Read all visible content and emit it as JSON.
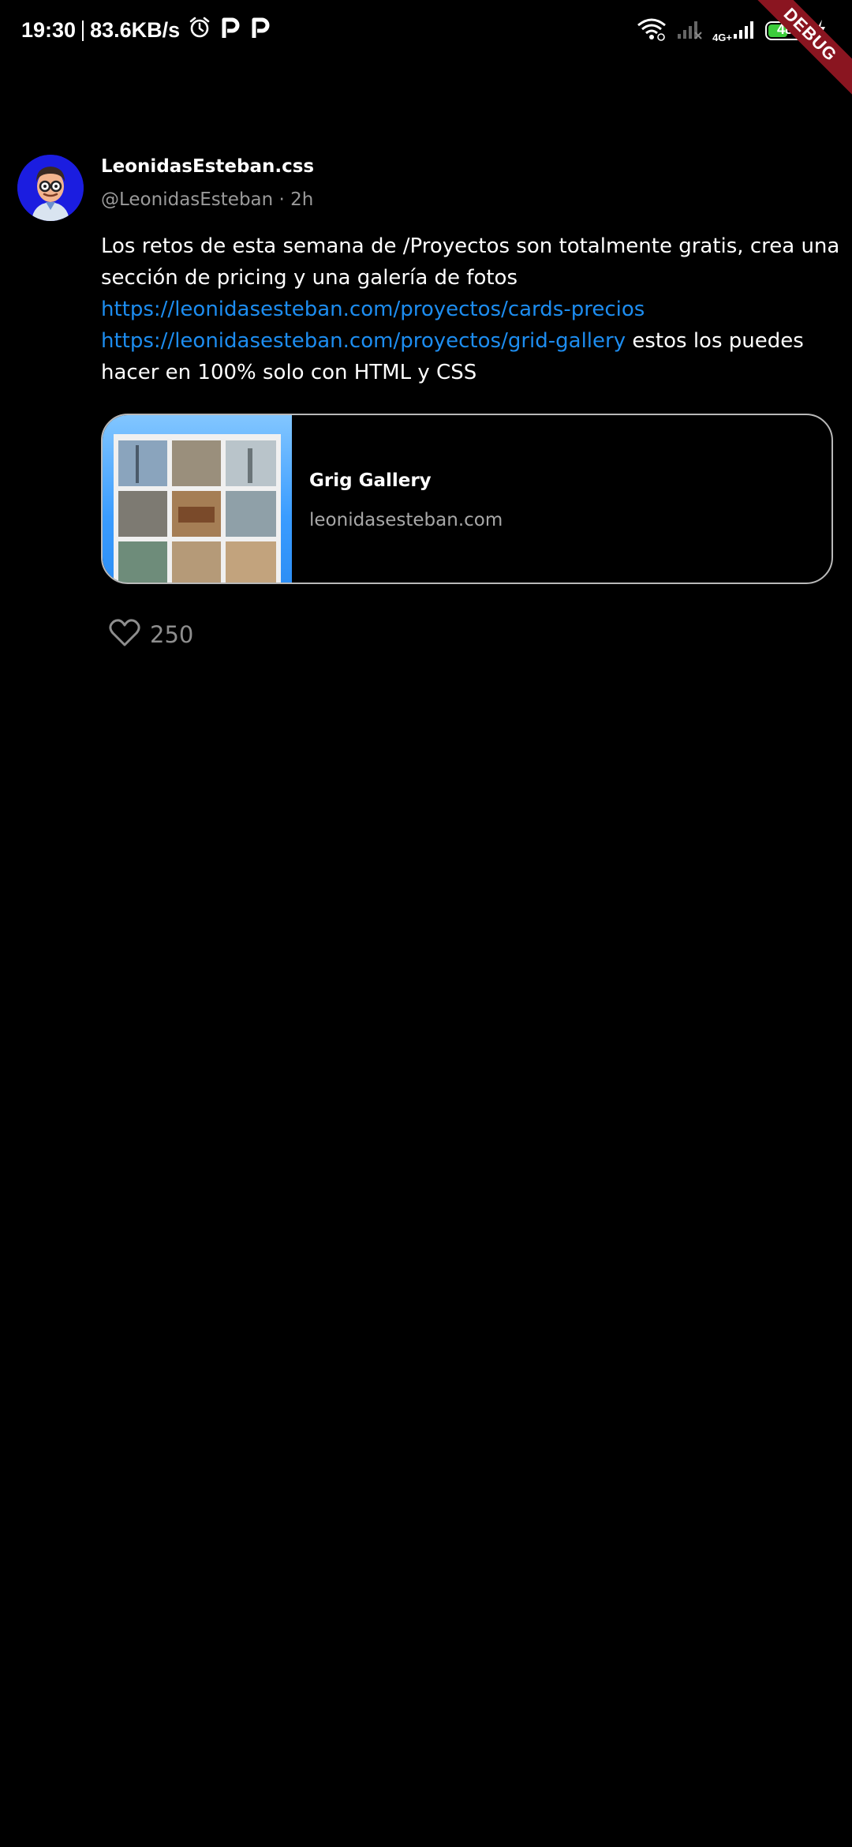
{
  "status_bar": {
    "time": "19:30",
    "net_speed": "83.6KB/s",
    "network_type": "4G+",
    "battery_level": "48",
    "debug_label": "DEBUG"
  },
  "tweet": {
    "display_name": "LeonidasEsteban.css",
    "handle": "@LeonidasEsteban",
    "separator": " · ",
    "time_ago": "2h",
    "text_part1": "Los retos de esta semana de /Proyectos son totalmente gratis, crea una sección de pricing y una galería de fotos ",
    "link1": "https://leonidasesteban.com/proyectos/cards-precios",
    "link2": "https://leonidasesteban.com/proyectos/grid-gallery",
    "text_part2": " estos los puedes hacer en 100% solo con HTML y CSS",
    "card": {
      "title": "Grig Gallery",
      "domain": "leonidasesteban.com"
    },
    "likes": "250"
  },
  "colors": {
    "background": "#000000",
    "link": "#1d8df0",
    "secondary_text": "#9a9a9a",
    "card_border": "#b9b9b9"
  }
}
